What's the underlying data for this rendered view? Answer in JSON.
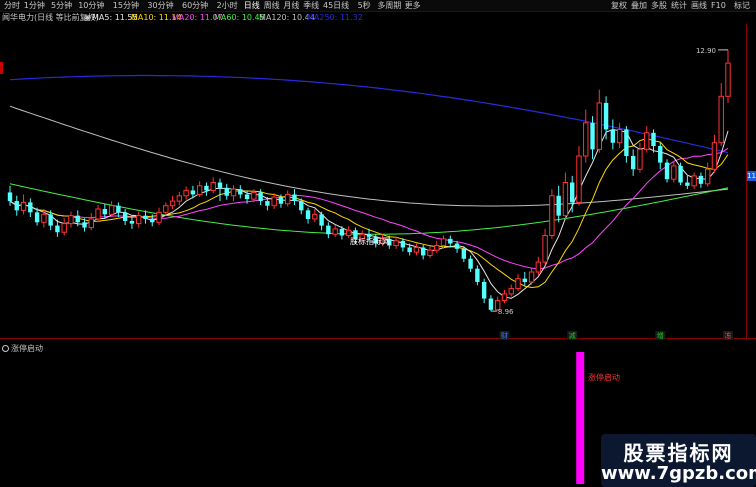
{
  "toolbar": {
    "periods": [
      "分时",
      "1分钟",
      "5分钟",
      "10分钟",
      "15分钟",
      "30分钟",
      "60分钟",
      "2小时",
      "日线",
      "周线",
      "月线",
      "季线",
      "45日线",
      "5秒",
      "多周期",
      "更多"
    ],
    "selected_period": "日线",
    "right_buttons": [
      "复权",
      "叠加",
      "多股",
      "统计",
      "画线",
      "F10",
      "标记"
    ]
  },
  "info_bar": {
    "title": "闻华电力(日线 等比前复权)",
    "ma5": "MA5: 11.55",
    "ma10": "MA10: 11.14",
    "ma20": "MA20: 11.07",
    "ma60": "MA60: 10.45",
    "ma120": "MA120: 10.44",
    "ma250": "MA250: 11.32"
  },
  "colors": {
    "up": "#ff3232",
    "down": "#54ffff",
    "ma5": "#e6e6e6",
    "ma10": "#ffd700",
    "ma20": "#ff44ff",
    "ma60": "#44ee44",
    "ma120": "#bfbfbf",
    "ma250": "#2a2adc",
    "indicator_bar": "#ff00ff",
    "marker_blue": "#4477ff",
    "marker_green": "#22cc22",
    "marker_red": "#ff4444"
  },
  "chart_data": {
    "type": "candlestick",
    "title": "闻华电力(日线 等比前复权)",
    "ylim": [
      8.6,
      13.2
    ],
    "price_high_label": "12.90",
    "price_low_label": "8.96",
    "watermark_center": "股标指标网",
    "last_price_tag": "11",
    "markers": [
      {
        "text": "财",
        "color": "#4477ff"
      },
      {
        "text": "减",
        "color": "#22cc22"
      },
      {
        "text": "增",
        "color": "#22cc22"
      },
      {
        "text": "冻",
        "color": "#ff4444"
      }
    ],
    "candles": [
      [
        10.75,
        10.62,
        10.85,
        10.55
      ],
      [
        10.62,
        10.48,
        10.7,
        10.4
      ],
      [
        10.48,
        10.6,
        10.72,
        10.42
      ],
      [
        10.6,
        10.45,
        10.66,
        10.38
      ],
      [
        10.45,
        10.3,
        10.52,
        10.25
      ],
      [
        10.3,
        10.42,
        10.5,
        10.22
      ],
      [
        10.42,
        10.25,
        10.48,
        10.18
      ],
      [
        10.25,
        10.15,
        10.34,
        10.08
      ],
      [
        10.15,
        10.28,
        10.36,
        10.1
      ],
      [
        10.28,
        10.4,
        10.46,
        10.22
      ],
      [
        10.4,
        10.3,
        10.48,
        10.24
      ],
      [
        10.3,
        10.22,
        10.36,
        10.16
      ],
      [
        10.22,
        10.35,
        10.44,
        10.18
      ],
      [
        10.35,
        10.5,
        10.56,
        10.3
      ],
      [
        10.5,
        10.42,
        10.58,
        10.36
      ],
      [
        10.42,
        10.55,
        10.62,
        10.38
      ],
      [
        10.55,
        10.45,
        10.6,
        10.38
      ],
      [
        10.45,
        10.32,
        10.5,
        10.26
      ],
      [
        10.32,
        10.28,
        10.4,
        10.2
      ],
      [
        10.28,
        10.4,
        10.46,
        10.22
      ],
      [
        10.4,
        10.35,
        10.48,
        10.28
      ],
      [
        10.35,
        10.3,
        10.42,
        10.24
      ],
      [
        10.3,
        10.45,
        10.52,
        10.26
      ],
      [
        10.45,
        10.55,
        10.6,
        10.4
      ],
      [
        10.55,
        10.62,
        10.7,
        10.5
      ],
      [
        10.62,
        10.7,
        10.76,
        10.56
      ],
      [
        10.7,
        10.78,
        10.84,
        10.64
      ],
      [
        10.78,
        10.72,
        10.85,
        10.66
      ],
      [
        10.72,
        10.85,
        10.92,
        10.68
      ],
      [
        10.85,
        10.78,
        10.9,
        10.7
      ],
      [
        10.78,
        10.9,
        10.98,
        10.74
      ],
      [
        10.9,
        10.82,
        10.96,
        10.62
      ],
      [
        10.82,
        10.7,
        10.88,
        10.64
      ],
      [
        10.7,
        10.8,
        10.86,
        10.62
      ],
      [
        10.8,
        10.72,
        10.86,
        10.66
      ],
      [
        10.72,
        10.65,
        10.78,
        10.58
      ],
      [
        10.65,
        10.75,
        10.8,
        10.6
      ],
      [
        10.75,
        10.62,
        10.8,
        10.56
      ],
      [
        10.62,
        10.55,
        10.68,
        10.48
      ],
      [
        10.55,
        10.68,
        10.74,
        10.5
      ],
      [
        10.68,
        10.58,
        10.72,
        10.52
      ],
      [
        10.58,
        10.72,
        10.78,
        10.54
      ],
      [
        10.72,
        10.62,
        10.8,
        10.56
      ],
      [
        10.62,
        10.48,
        10.66,
        10.42
      ],
      [
        10.48,
        10.35,
        10.52,
        10.28
      ],
      [
        10.35,
        10.42,
        10.5,
        10.3
      ],
      [
        10.42,
        10.25,
        10.46,
        10.18
      ],
      [
        10.25,
        10.12,
        10.3,
        10.06
      ],
      [
        10.12,
        10.2,
        10.26,
        10.08
      ],
      [
        10.2,
        10.1,
        10.24,
        10.04
      ],
      [
        10.1,
        10.18,
        10.24,
        10.06
      ],
      [
        10.18,
        10.05,
        10.22,
        9.98
      ],
      [
        10.05,
        10.12,
        10.18,
        10.0
      ],
      [
        10.12,
        10.08,
        10.2,
        10.02
      ],
      [
        10.08,
        9.98,
        10.12,
        9.92
      ],
      [
        9.98,
        10.05,
        10.12,
        9.94
      ],
      [
        10.05,
        9.95,
        10.1,
        9.9
      ],
      [
        9.95,
        10.02,
        10.08,
        9.9
      ],
      [
        10.02,
        9.92,
        10.06,
        9.86
      ],
      [
        9.92,
        9.85,
        9.98,
        9.8
      ],
      [
        9.85,
        9.92,
        9.98,
        9.8
      ],
      [
        9.92,
        9.8,
        9.96,
        9.74
      ],
      [
        9.8,
        9.88,
        9.94,
        9.76
      ],
      [
        9.88,
        9.95,
        10.02,
        9.84
      ],
      [
        9.95,
        10.05,
        10.1,
        9.9
      ],
      [
        10.05,
        9.98,
        10.1,
        9.92
      ],
      [
        9.98,
        9.9,
        10.02,
        9.84
      ],
      [
        9.9,
        9.75,
        9.94,
        9.7
      ],
      [
        9.75,
        9.6,
        9.8,
        9.55
      ],
      [
        9.6,
        9.4,
        9.65,
        9.35
      ],
      [
        9.4,
        9.15,
        9.45,
        9.08
      ],
      [
        9.15,
        8.98,
        9.2,
        8.96
      ],
      [
        8.98,
        9.12,
        9.18,
        8.96
      ],
      [
        9.12,
        9.22,
        9.28,
        9.08
      ],
      [
        9.22,
        9.3,
        9.36,
        9.18
      ],
      [
        9.3,
        9.45,
        9.52,
        9.26
      ],
      [
        9.45,
        9.4,
        9.55,
        9.35
      ],
      [
        9.4,
        9.55,
        9.62,
        9.36
      ],
      [
        9.55,
        9.7,
        9.78,
        9.5
      ],
      [
        9.7,
        10.1,
        10.2,
        9.65
      ],
      [
        10.1,
        10.7,
        10.8,
        10.05
      ],
      [
        10.7,
        10.4,
        10.85,
        10.3
      ],
      [
        10.4,
        10.9,
        11.05,
        10.35
      ],
      [
        10.9,
        10.6,
        11.0,
        10.45
      ],
      [
        10.6,
        11.3,
        11.45,
        10.55
      ],
      [
        11.3,
        11.8,
        12.0,
        11.2
      ],
      [
        11.8,
        11.4,
        11.9,
        11.25
      ],
      [
        11.4,
        12.1,
        12.3,
        11.35
      ],
      [
        12.1,
        11.7,
        12.2,
        11.55
      ],
      [
        11.7,
        11.5,
        11.85,
        11.4
      ],
      [
        11.5,
        11.7,
        11.8,
        11.42
      ],
      [
        11.7,
        11.3,
        11.75,
        11.2
      ],
      [
        11.3,
        11.1,
        11.4,
        11.0
      ],
      [
        11.1,
        11.4,
        11.5,
        11.05
      ],
      [
        11.4,
        11.65,
        11.75,
        11.35
      ],
      [
        11.65,
        11.45,
        11.7,
        11.35
      ],
      [
        11.45,
        11.2,
        11.5,
        11.1
      ],
      [
        11.2,
        10.95,
        11.25,
        10.9
      ],
      [
        10.95,
        11.15,
        11.22,
        10.9
      ],
      [
        11.15,
        10.9,
        11.2,
        10.86
      ],
      [
        10.9,
        10.85,
        11.0,
        10.8
      ],
      [
        10.85,
        11.0,
        11.05,
        10.8
      ],
      [
        11.0,
        10.88,
        11.05,
        10.82
      ],
      [
        10.88,
        11.1,
        11.2,
        10.84
      ],
      [
        11.1,
        11.5,
        11.62,
        11.05
      ],
      [
        11.5,
        12.2,
        12.4,
        11.45
      ],
      [
        12.2,
        12.7,
        12.9,
        12.1
      ]
    ],
    "indicator": {
      "name": "涨停启动",
      "signal_label": "涨停启动",
      "signal_index": 83
    }
  },
  "watermark": {
    "title": "股票指标网",
    "url": "www.7gpzb.com"
  }
}
